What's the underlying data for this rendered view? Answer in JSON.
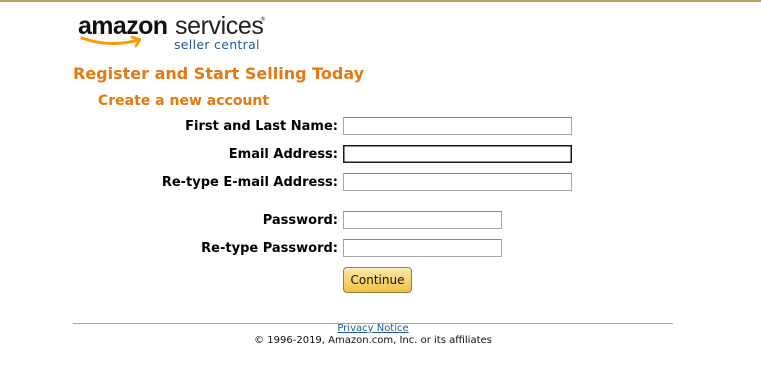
{
  "logo": {
    "brand": "amazon",
    "product": "services",
    "trademark": "®",
    "subtitle": "seller central",
    "smile_color": "#f90"
  },
  "page": {
    "heading": "Register and Start Selling Today",
    "subheading": "Create a new account",
    "accent_color": "#e47911"
  },
  "form": {
    "name_label": "First and Last Name:",
    "name_value": "",
    "email_label": "Email Address:",
    "email_value": "",
    "email_confirm_label": "Re-type E-mail Address:",
    "email_confirm_value": "",
    "password_label": "Password:",
    "password_value": "",
    "password_confirm_label": "Re-type Password:",
    "password_confirm_value": "",
    "submit_label": "Continue"
  },
  "footer": {
    "privacy_link": "Privacy Notice",
    "copyright": "© 1996-2019, Amazon.com, Inc. or its affiliates",
    "link_color": "#1f5a95"
  }
}
